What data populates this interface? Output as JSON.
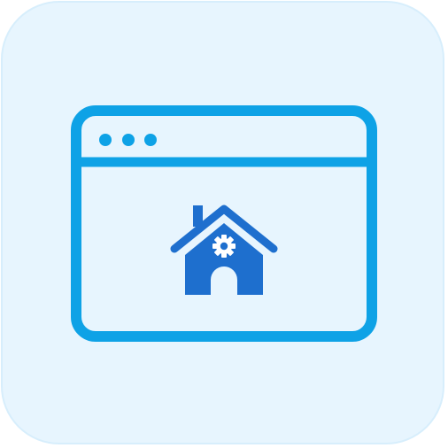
{
  "icon": {
    "name": "web-browser-smart-home-icon",
    "parts": [
      "browser-window-icon",
      "house-icon",
      "gear-icon"
    ],
    "colors": {
      "tile_background": "#e7f5fe",
      "tile_border": "#d7eefc",
      "window_stroke": "#0ea2e6",
      "house_fill": "#1e6fce",
      "gear_fill": "#ffffff"
    }
  }
}
